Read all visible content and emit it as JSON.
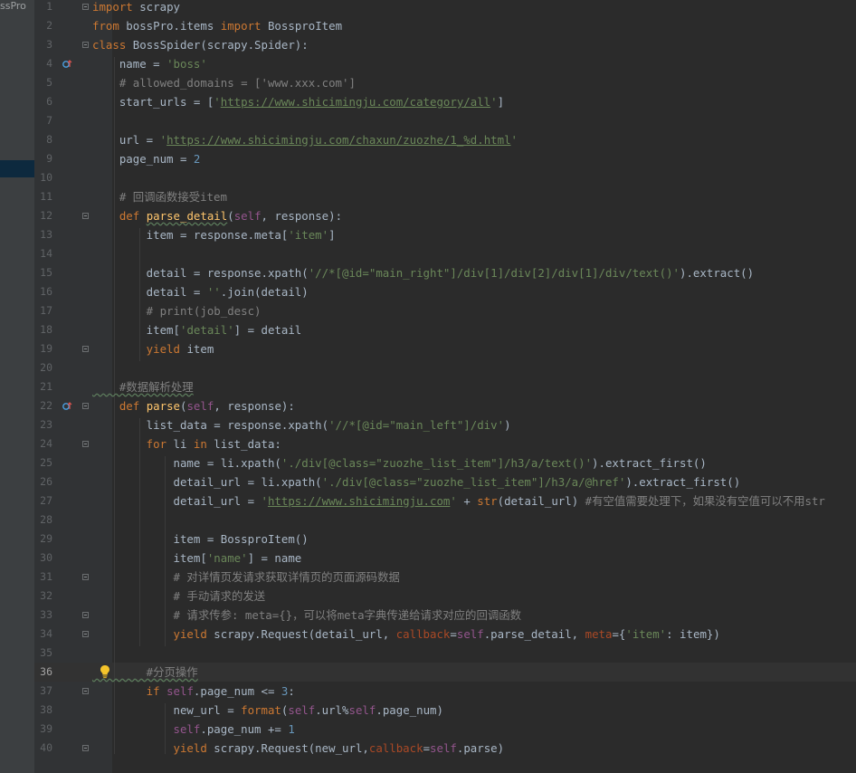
{
  "sidebar": {
    "project_label": "ssPro"
  },
  "editor": {
    "current_line": 36,
    "lines": [
      {
        "n": "1",
        "t": [
          {
            "k": "kw",
            "v": "import"
          },
          {
            "k": "",
            "v": " scrapy"
          }
        ]
      },
      {
        "n": "2",
        "t": [
          {
            "k": "kw",
            "v": "from"
          },
          {
            "k": "",
            "v": " bossPro.items "
          },
          {
            "k": "kw",
            "v": "import"
          },
          {
            "k": "",
            "v": " BossproItem"
          }
        ]
      },
      {
        "n": "3",
        "t": [
          {
            "k": "kw",
            "v": "class"
          },
          {
            "k": "",
            "v": " BossSpider(scrapy.Spider):"
          }
        ]
      },
      {
        "n": "4",
        "t": [
          {
            "k": "",
            "v": "    name = "
          },
          {
            "k": "str",
            "v": "'boss'"
          }
        ]
      },
      {
        "n": "5",
        "t": [
          {
            "k": "cm",
            "v": "    # allowed_domains = ['www.xxx.com']"
          }
        ]
      },
      {
        "n": "6",
        "t": [
          {
            "k": "",
            "v": "    start_urls = ["
          },
          {
            "k": "str",
            "v": "'"
          },
          {
            "k": "url",
            "v": "https://www.shicimingju.com/category/all"
          },
          {
            "k": "str",
            "v": "'"
          },
          {
            "k": "",
            "v": "]"
          }
        ]
      },
      {
        "n": "7",
        "t": []
      },
      {
        "n": "8",
        "t": [
          {
            "k": "",
            "v": "    url = "
          },
          {
            "k": "str",
            "v": "'"
          },
          {
            "k": "url",
            "v": "https://www.shicimingju.com/chaxun/zuozhe/1_%d.html"
          },
          {
            "k": "str",
            "v": "'"
          }
        ]
      },
      {
        "n": "9",
        "t": [
          {
            "k": "",
            "v": "    page_num = "
          },
          {
            "k": "num",
            "v": "2"
          }
        ]
      },
      {
        "n": "10",
        "t": []
      },
      {
        "n": "11",
        "t": [
          {
            "k": "cm",
            "v": "    # 回调函数接受item"
          }
        ]
      },
      {
        "n": "12",
        "t": [
          {
            "k": "kw",
            "v": "    def "
          },
          {
            "k": "fn",
            "v": "parse_detail"
          },
          {
            "k": "",
            "v": "("
          },
          {
            "k": "self",
            "v": "self"
          },
          {
            "k": "",
            "v": ", response):"
          }
        ]
      },
      {
        "n": "13",
        "t": [
          {
            "k": "",
            "v": "        item = response.meta["
          },
          {
            "k": "str",
            "v": "'item'"
          },
          {
            "k": "",
            "v": "]"
          }
        ]
      },
      {
        "n": "14",
        "t": []
      },
      {
        "n": "15",
        "t": [
          {
            "k": "",
            "v": "        detail = response.xpath("
          },
          {
            "k": "str",
            "v": "'//*[@id=\"main_right\"]/div[1]/div[2]/div[1]/div/text()'"
          },
          {
            "k": "",
            "v": ").extract()"
          }
        ]
      },
      {
        "n": "16",
        "t": [
          {
            "k": "",
            "v": "        detail = "
          },
          {
            "k": "str",
            "v": "''"
          },
          {
            "k": "",
            "v": ".join(detail)"
          }
        ]
      },
      {
        "n": "17",
        "t": [
          {
            "k": "cm",
            "v": "        # print(job_desc)"
          }
        ]
      },
      {
        "n": "18",
        "t": [
          {
            "k": "",
            "v": "        item["
          },
          {
            "k": "str",
            "v": "'detail'"
          },
          {
            "k": "",
            "v": "] = detail"
          }
        ]
      },
      {
        "n": "19",
        "t": [
          {
            "k": "kw",
            "v": "        yield"
          },
          {
            "k": "",
            "v": " item"
          }
        ]
      },
      {
        "n": "20",
        "t": []
      },
      {
        "n": "21",
        "t": [
          {
            "k": "cm",
            "v": "    #数据解析处理"
          }
        ]
      },
      {
        "n": "22",
        "t": [
          {
            "k": "kw",
            "v": "    def "
          },
          {
            "k": "fn",
            "v": "parse"
          },
          {
            "k": "",
            "v": "("
          },
          {
            "k": "self",
            "v": "self"
          },
          {
            "k": "",
            "v": ", response):"
          }
        ]
      },
      {
        "n": "23",
        "t": [
          {
            "k": "",
            "v": "        list_data = response.xpath("
          },
          {
            "k": "str",
            "v": "'//*[@id=\"main_left\"]/div'"
          },
          {
            "k": "",
            "v": ")"
          }
        ]
      },
      {
        "n": "24",
        "t": [
          {
            "k": "kw",
            "v": "        for"
          },
          {
            "k": "",
            "v": " li "
          },
          {
            "k": "kw",
            "v": "in"
          },
          {
            "k": "",
            "v": " list_data:"
          }
        ]
      },
      {
        "n": "25",
        "t": [
          {
            "k": "",
            "v": "            name = li.xpath("
          },
          {
            "k": "str",
            "v": "'./div[@class=\"zuozhe_list_item\"]/h3/a/text()'"
          },
          {
            "k": "",
            "v": ").extract_first()"
          }
        ]
      },
      {
        "n": "26",
        "t": [
          {
            "k": "",
            "v": "            detail_url = li.xpath("
          },
          {
            "k": "str",
            "v": "'./div[@class=\"zuozhe_list_item\"]/h3/a/@href'"
          },
          {
            "k": "",
            "v": ").extract_first()"
          }
        ]
      },
      {
        "n": "27",
        "t": [
          {
            "k": "",
            "v": "            detail_url = "
          },
          {
            "k": "str",
            "v": "'"
          },
          {
            "k": "url",
            "v": "https://www.shicimingju.com"
          },
          {
            "k": "str",
            "v": "'"
          },
          {
            "k": "",
            "v": " + "
          },
          {
            "k": "kw",
            "v": "str"
          },
          {
            "k": "",
            "v": "(detail_url) "
          },
          {
            "k": "cm",
            "v": "#有空值需要处理下，如果没有空值可以不用str"
          }
        ]
      },
      {
        "n": "28",
        "t": []
      },
      {
        "n": "29",
        "t": [
          {
            "k": "",
            "v": "            item = BossproItem()"
          }
        ]
      },
      {
        "n": "30",
        "t": [
          {
            "k": "",
            "v": "            item["
          },
          {
            "k": "str",
            "v": "'name'"
          },
          {
            "k": "",
            "v": "] = name"
          }
        ]
      },
      {
        "n": "31",
        "t": [
          {
            "k": "cm",
            "v": "            # 对详情页发请求获取详情页的页面源码数据"
          }
        ]
      },
      {
        "n": "32",
        "t": [
          {
            "k": "cm",
            "v": "            # 手动请求的发送"
          }
        ]
      },
      {
        "n": "33",
        "t": [
          {
            "k": "cm",
            "v": "            # 请求传参: meta={}，可以将meta字典传递给请求对应的回调函数"
          }
        ]
      },
      {
        "n": "34",
        "t": [
          {
            "k": "kw",
            "v": "            yield"
          },
          {
            "k": "",
            "v": " scrapy.Request(detail_url, "
          },
          {
            "k": "kwa",
            "v": "callback"
          },
          {
            "k": "",
            "v": "="
          },
          {
            "k": "self",
            "v": "self"
          },
          {
            "k": "",
            "v": ".parse_detail, "
          },
          {
            "k": "kwa",
            "v": "meta"
          },
          {
            "k": "",
            "v": "={"
          },
          {
            "k": "str",
            "v": "'item'"
          },
          {
            "k": "",
            "v": ": item})"
          }
        ]
      },
      {
        "n": "35",
        "t": []
      },
      {
        "n": "36",
        "t": [
          {
            "k": "cm",
            "v": "        #分页操作"
          }
        ]
      },
      {
        "n": "37",
        "t": [
          {
            "k": "kw",
            "v": "        if "
          },
          {
            "k": "self",
            "v": "self"
          },
          {
            "k": "",
            "v": ".page_num <= "
          },
          {
            "k": "num",
            "v": "3"
          },
          {
            "k": "",
            "v": ":"
          }
        ]
      },
      {
        "n": "38",
        "t": [
          {
            "k": "",
            "v": "            new_url = "
          },
          {
            "k": "kw",
            "v": "format"
          },
          {
            "k": "",
            "v": "("
          },
          {
            "k": "self",
            "v": "self"
          },
          {
            "k": "",
            "v": ".url%"
          },
          {
            "k": "self",
            "v": "self"
          },
          {
            "k": "",
            "v": ".page_num)"
          }
        ]
      },
      {
        "n": "39",
        "t": [
          {
            "k": "self",
            "v": "            self"
          },
          {
            "k": "",
            "v": ".page_num += "
          },
          {
            "k": "num",
            "v": "1"
          }
        ]
      },
      {
        "n": "40",
        "t": [
          {
            "k": "kw",
            "v": "            yield"
          },
          {
            "k": "",
            "v": " scrapy.Request(new_url,"
          },
          {
            "k": "kwa",
            "v": "callback"
          },
          {
            "k": "",
            "v": "="
          },
          {
            "k": "self",
            "v": "self"
          },
          {
            "k": "",
            "v": ".parse)"
          }
        ]
      }
    ]
  },
  "colors": {
    "background": "#2b2b2b",
    "gutter": "#313335",
    "keyword": "#cc7832",
    "string": "#6a8759",
    "number": "#6897bb",
    "comment": "#808080",
    "function": "#ffc66d",
    "self": "#94558d"
  },
  "icons": {
    "override": "override-icon",
    "intention": "lightbulb-icon",
    "fold": "fold-marker-icon"
  }
}
